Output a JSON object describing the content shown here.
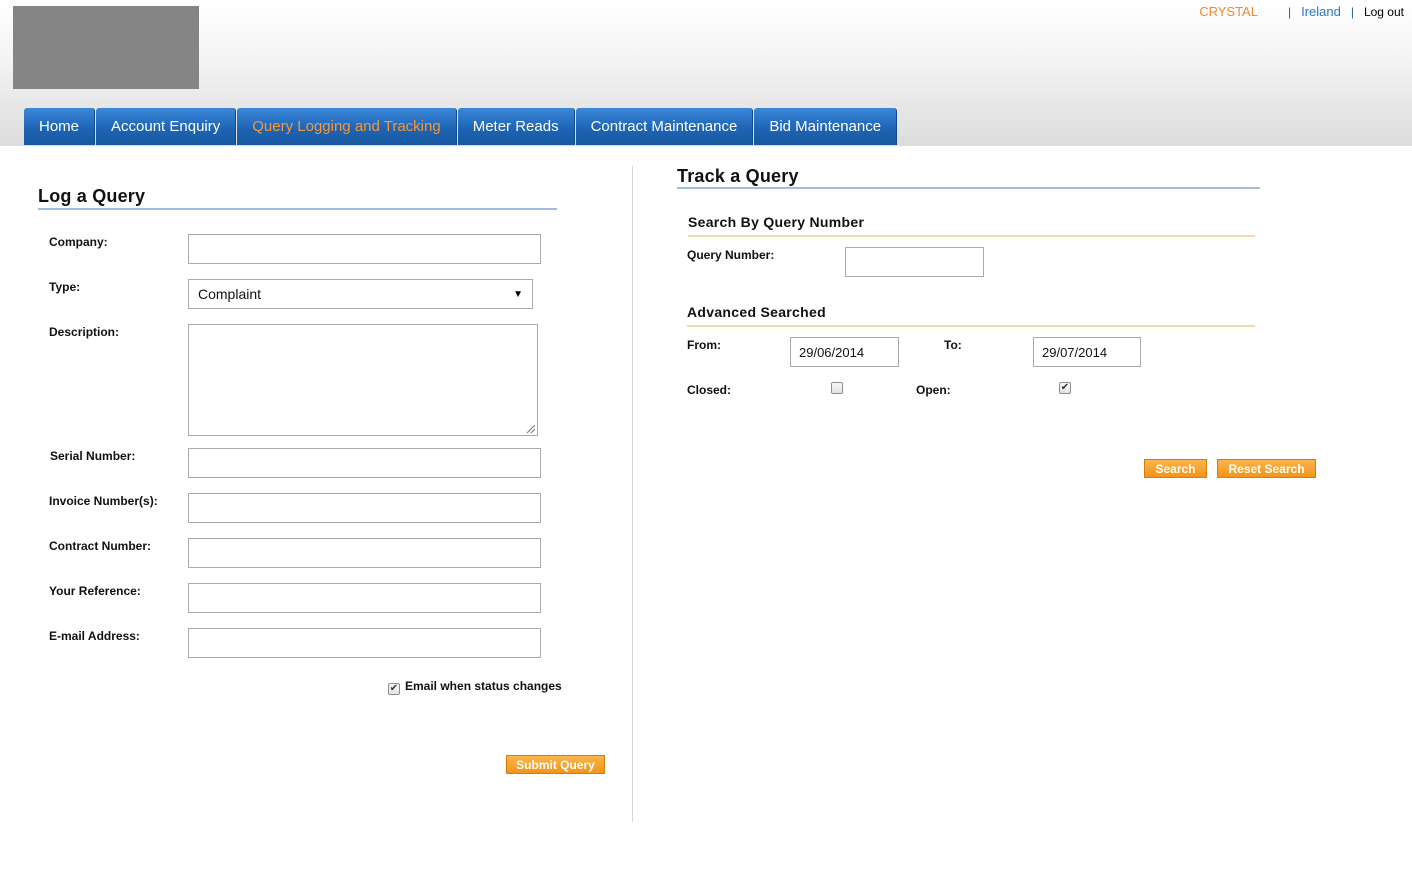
{
  "header": {
    "user": "CRYSTAL",
    "region": "Ireland",
    "logout": "Log out",
    "separator": "|"
  },
  "nav": {
    "tabs": [
      {
        "label": "Home"
      },
      {
        "label": "Account Enquiry"
      },
      {
        "label": "Query Logging and Tracking",
        "active": true
      },
      {
        "label": "Meter Reads"
      },
      {
        "label": "Contract Maintenance"
      },
      {
        "label": "Bid Maintenance"
      }
    ]
  },
  "log_query": {
    "title": "Log a Query",
    "company_label": "Company:",
    "company_value": "",
    "type_label": "Type:",
    "type_value": "Complaint",
    "description_label": "Description:",
    "description_value": "",
    "serial_label": "Serial Number:",
    "serial_value": "",
    "invoice_label": "Invoice Number(s):",
    "invoice_value": "",
    "contract_label": "Contract Number:",
    "contract_value": "",
    "reference_label": "Your Reference:",
    "reference_value": "",
    "email_label": "E-mail Address:",
    "email_value": "",
    "email_status_label": "Email when status changes",
    "email_status_checked": true,
    "submit_label": "Submit Query"
  },
  "track_query": {
    "title": "Track a Query",
    "search_by_number_title": "Search By Query Number",
    "query_number_label": "Query Number:",
    "query_number_value": "",
    "advanced_title": "Advanced Searched",
    "from_label": "From:",
    "from_value": "29/06/2014",
    "to_label": "To:",
    "to_value": "29/07/2014",
    "closed_label": "Closed:",
    "closed_checked": false,
    "open_label": "Open:",
    "open_checked": true,
    "search_label": "Search",
    "reset_label": "Reset Search"
  },
  "colors": {
    "nav_blue": "#1f65b5",
    "active_tab_text": "#f7973a",
    "button_orange": "#f29517",
    "user_orange": "#f0892f",
    "link_blue": "#2d74c4"
  }
}
